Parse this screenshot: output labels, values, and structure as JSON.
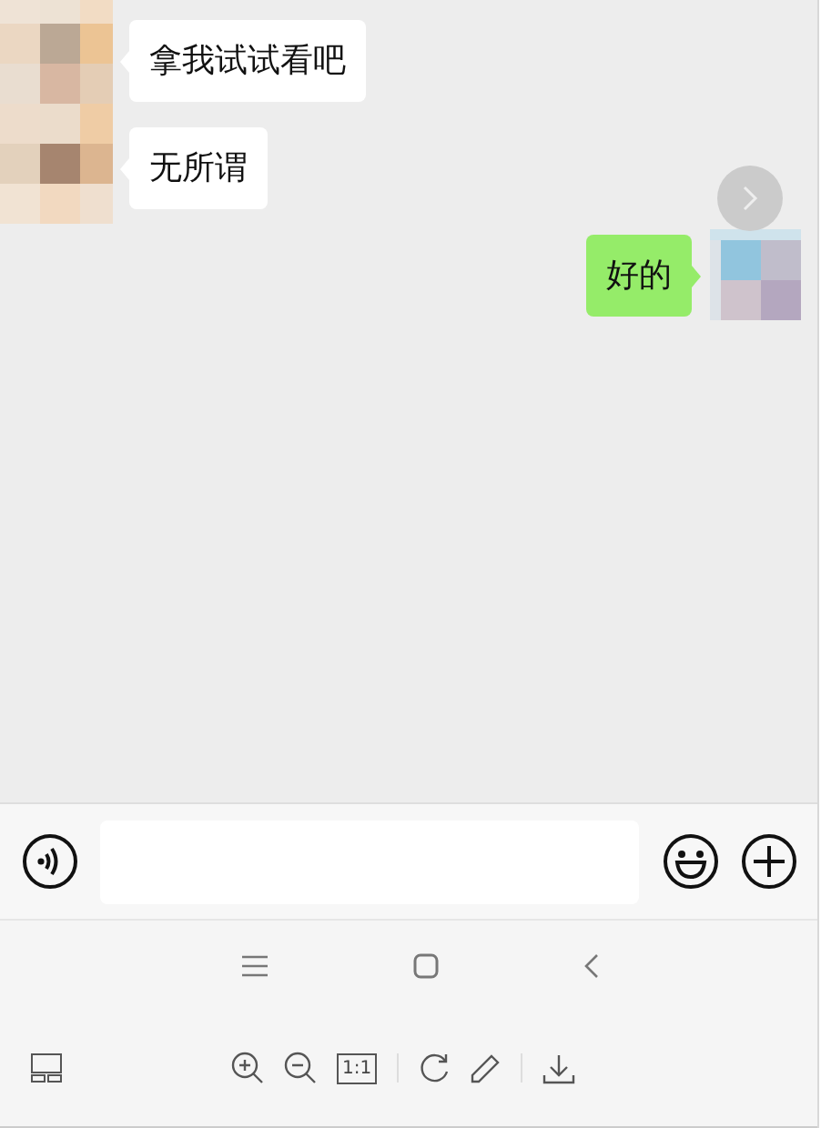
{
  "messages": [
    {
      "kind": "incoming",
      "text": "拿我试试看吧"
    },
    {
      "kind": "incoming",
      "text": "无所谓"
    },
    {
      "kind": "outgoing",
      "text": "好的"
    }
  ],
  "viewer_toolbar": {
    "actual_size_label": "1:1"
  }
}
